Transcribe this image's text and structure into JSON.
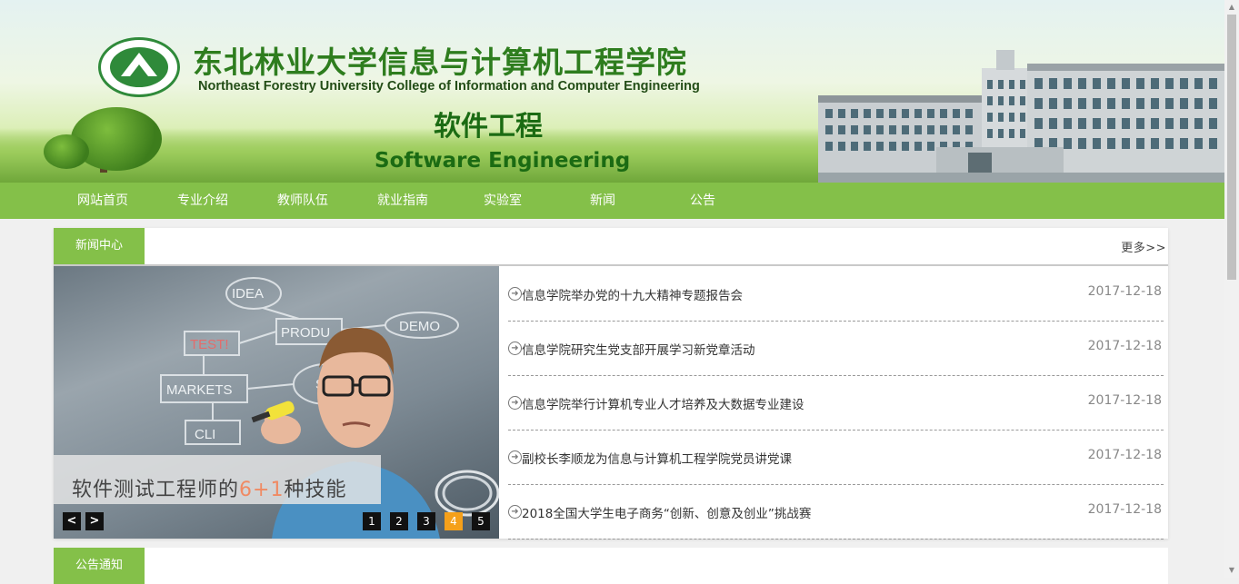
{
  "header": {
    "school_cn": "东北林业大学信息与计算机工程学院",
    "school_en": "Northeast Forestry University  College of Information and Computer Engineering",
    "major_cn": "软件工程",
    "major_en": "Software Engineering",
    "logo_icon": "university-seal-icon"
  },
  "nav": {
    "items": [
      {
        "label": "网站首页"
      },
      {
        "label": "专业介绍"
      },
      {
        "label": "教师队伍"
      },
      {
        "label": "就业指南"
      },
      {
        "label": "实验室"
      },
      {
        "label": "新闻"
      },
      {
        "label": "公告"
      }
    ],
    "color": "#84c049"
  },
  "news": {
    "section_title": "新闻中心",
    "more_label": "更多>>",
    "slider": {
      "caption_before": "软件测试工程师的",
      "caption_highlight": "6+1",
      "caption_after": "种技能",
      "art_labels": [
        "IDEA",
        "PRODU",
        "DEMO",
        "TEST!",
        "MARKETS",
        "S",
        "CLI"
      ],
      "prev_label": "<",
      "next_label": ">",
      "pages": [
        "1",
        "2",
        "3",
        "4",
        "5"
      ],
      "active_page": "4",
      "active_color": "#f5a01a"
    },
    "items": [
      {
        "title": "信息学院举办党的十九大精神专题报告会",
        "date": "2017-12-18"
      },
      {
        "title": "信息学院研究生党支部开展学习新党章活动",
        "date": "2017-12-18"
      },
      {
        "title": "信息学院举行计算机专业人才培养及大数据专业建设",
        "date": "2017-12-18"
      },
      {
        "title": "副校长李顺龙为信息与计算机工程学院党员讲党课",
        "date": "2017-12-18"
      },
      {
        "title": "2018全国大学生电子商务“创新、创意及创业”挑战赛",
        "date": "2017-12-18"
      }
    ]
  },
  "notice": {
    "section_title": "公告通知"
  },
  "scrollbar": {
    "up": "▲",
    "down": "▼"
  }
}
